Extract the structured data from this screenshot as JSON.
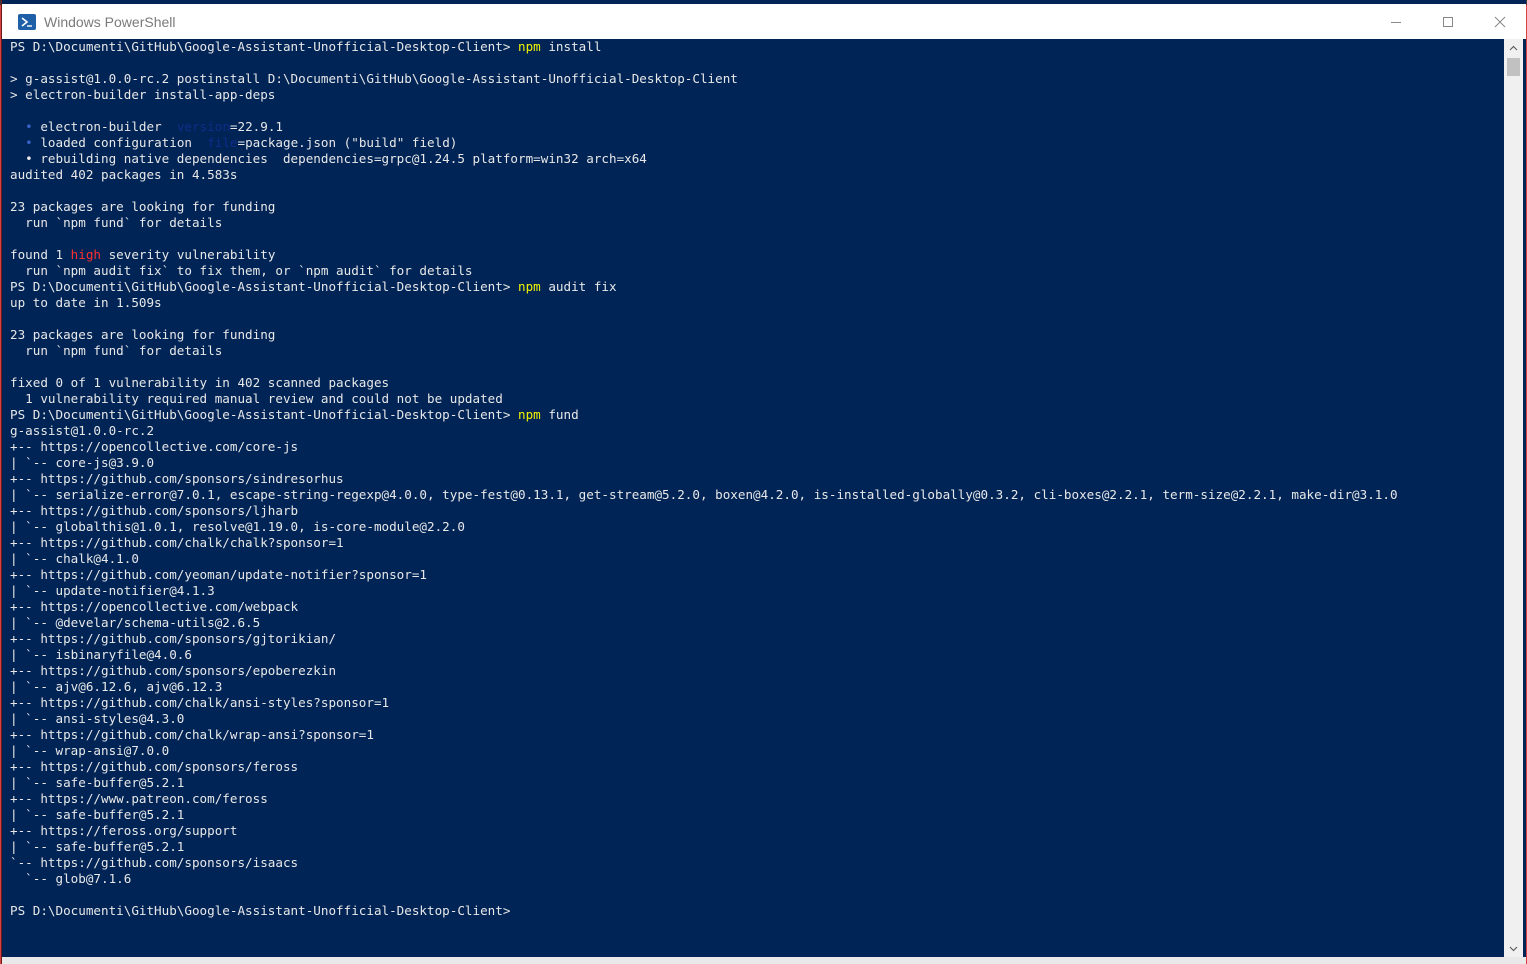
{
  "window": {
    "title": "Windows PowerShell",
    "controls": {
      "minimize": "minimize-icon",
      "maximize": "maximize-icon",
      "close": "close-icon"
    }
  },
  "colors": {
    "console_bg": "#012456",
    "text": "#e8e8e8",
    "command": "#f2f200",
    "error": "#ff3030"
  },
  "console": {
    "lines": [
      [
        {
          "t": "PS D:\\Documenti\\GitHub\\Google-Assistant-Unofficial-Desktop-Client> "
        },
        {
          "t": "npm",
          "c": "cmd"
        },
        {
          "t": " install"
        }
      ],
      [
        {
          "t": ""
        }
      ],
      [
        {
          "t": "> g-assist@1.0.0-rc.2 postinstall D:\\Documenti\\GitHub\\Google-Assistant-Unofficial-Desktop-Client"
        }
      ],
      [
        {
          "t": "> electron-builder install-app-deps"
        }
      ],
      [
        {
          "t": ""
        }
      ],
      [
        {
          "t": "  "
        },
        {
          "t": "•",
          "c": "dot"
        },
        {
          "t": " electron-builder  "
        },
        {
          "t": "version",
          "c": "dim"
        },
        {
          "t": "=22.9.1"
        }
      ],
      [
        {
          "t": "  "
        },
        {
          "t": "•",
          "c": "dot"
        },
        {
          "t": " loaded configuration  "
        },
        {
          "t": "file",
          "c": "dim"
        },
        {
          "t": "=package.json (\"build\" field)"
        }
      ],
      [
        {
          "t": "  • rebuilding native dependencies  dependencies=grpc@1.24.5 platform=win32 arch=x64"
        }
      ],
      [
        {
          "t": "audited 402 packages in 4.583s"
        }
      ],
      [
        {
          "t": ""
        }
      ],
      [
        {
          "t": "23 packages are looking for funding"
        }
      ],
      [
        {
          "t": "  run `npm fund` for details"
        }
      ],
      [
        {
          "t": ""
        }
      ],
      [
        {
          "t": "found 1 "
        },
        {
          "t": "high",
          "c": "err"
        },
        {
          "t": " severity vulnerability"
        }
      ],
      [
        {
          "t": "  run `npm audit fix` to fix them, or `npm audit` for details"
        }
      ],
      [
        {
          "t": "PS D:\\Documenti\\GitHub\\Google-Assistant-Unofficial-Desktop-Client> "
        },
        {
          "t": "npm",
          "c": "cmd"
        },
        {
          "t": " audit fix"
        }
      ],
      [
        {
          "t": "up to date in 1.509s"
        }
      ],
      [
        {
          "t": ""
        }
      ],
      [
        {
          "t": "23 packages are looking for funding"
        }
      ],
      [
        {
          "t": "  run `npm fund` for details"
        }
      ],
      [
        {
          "t": ""
        }
      ],
      [
        {
          "t": "fixed 0 of 1 vulnerability in 402 scanned packages"
        }
      ],
      [
        {
          "t": "  1 vulnerability required manual review and could not be updated"
        }
      ],
      [
        {
          "t": "PS D:\\Documenti\\GitHub\\Google-Assistant-Unofficial-Desktop-Client> "
        },
        {
          "t": "npm",
          "c": "cmd"
        },
        {
          "t": " fund"
        }
      ],
      [
        {
          "t": "g-assist@1.0.0-rc.2"
        }
      ],
      [
        {
          "t": "+-- https://opencollective.com/core-js"
        }
      ],
      [
        {
          "t": "| `-- core-js@3.9.0"
        }
      ],
      [
        {
          "t": "+-- https://github.com/sponsors/sindresorhus"
        }
      ],
      [
        {
          "t": "| `-- serialize-error@7.0.1, escape-string-regexp@4.0.0, type-fest@0.13.1, get-stream@5.2.0, boxen@4.2.0, is-installed-globally@0.3.2, cli-boxes@2.2.1, term-size@2.2.1, make-dir@3.1.0"
        }
      ],
      [
        {
          "t": "+-- https://github.com/sponsors/ljharb"
        }
      ],
      [
        {
          "t": "| `-- globalthis@1.0.1, resolve@1.19.0, is-core-module@2.2.0"
        }
      ],
      [
        {
          "t": "+-- https://github.com/chalk/chalk?sponsor=1"
        }
      ],
      [
        {
          "t": "| `-- chalk@4.1.0"
        }
      ],
      [
        {
          "t": "+-- https://github.com/yeoman/update-notifier?sponsor=1"
        }
      ],
      [
        {
          "t": "| `-- update-notifier@4.1.3"
        }
      ],
      [
        {
          "t": "+-- https://opencollective.com/webpack"
        }
      ],
      [
        {
          "t": "| `-- @develar/schema-utils@2.6.5"
        }
      ],
      [
        {
          "t": "+-- https://github.com/sponsors/gjtorikian/"
        }
      ],
      [
        {
          "t": "| `-- isbinaryfile@4.0.6"
        }
      ],
      [
        {
          "t": "+-- https://github.com/sponsors/epoberezkin"
        }
      ],
      [
        {
          "t": "| `-- ajv@6.12.6, ajv@6.12.3"
        }
      ],
      [
        {
          "t": "+-- https://github.com/chalk/ansi-styles?sponsor=1"
        }
      ],
      [
        {
          "t": "| `-- ansi-styles@4.3.0"
        }
      ],
      [
        {
          "t": "+-- https://github.com/chalk/wrap-ansi?sponsor=1"
        }
      ],
      [
        {
          "t": "| `-- wrap-ansi@7.0.0"
        }
      ],
      [
        {
          "t": "+-- https://github.com/sponsors/feross"
        }
      ],
      [
        {
          "t": "| `-- safe-buffer@5.2.1"
        }
      ],
      [
        {
          "t": "+-- https://www.patreon.com/feross"
        }
      ],
      [
        {
          "t": "| `-- safe-buffer@5.2.1"
        }
      ],
      [
        {
          "t": "+-- https://feross.org/support"
        }
      ],
      [
        {
          "t": "| `-- safe-buffer@5.2.1"
        }
      ],
      [
        {
          "t": "`-- https://github.com/sponsors/isaacs"
        }
      ],
      [
        {
          "t": "  `-- glob@7.1.6"
        }
      ],
      [
        {
          "t": ""
        }
      ],
      [
        {
          "t": "PS D:\\Documenti\\GitHub\\Google-Assistant-Unofficial-Desktop-Client>"
        }
      ]
    ]
  }
}
